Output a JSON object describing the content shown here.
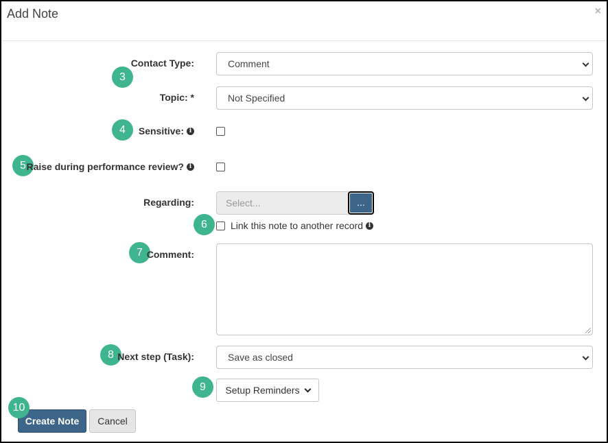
{
  "modal": {
    "title": "Add Note",
    "close_symbol": "×"
  },
  "form": {
    "contact_type": {
      "label": "Contact Type:",
      "value": "Comment"
    },
    "topic": {
      "label": "Topic: *",
      "value": "Not Specified"
    },
    "sensitive": {
      "label": "Sensitive:",
      "checked": false
    },
    "raise_review": {
      "label": "Raise during performance review?",
      "checked": false
    },
    "regarding": {
      "label": "Regarding:",
      "placeholder": "Select...",
      "button_label": "..."
    },
    "link_record": {
      "label": "Link this note to another record",
      "checked": false
    },
    "comment": {
      "label": "Comment:",
      "value": ""
    },
    "next_step": {
      "label": "Next step (Task):",
      "value": "Save as closed"
    },
    "reminders": {
      "label": "Setup Reminders"
    }
  },
  "footer": {
    "create_label": "Create Note",
    "cancel_label": "Cancel"
  },
  "badges": [
    "3",
    "4",
    "5",
    "6",
    "7",
    "8",
    "9",
    "10"
  ],
  "icons": {
    "info": "info-circle-icon",
    "chevron": "chevron-down-icon",
    "close": "close-icon",
    "resize": "resize-handle-icon"
  },
  "colors": {
    "primary": "#3d6489",
    "badge": "#3fb58f",
    "border": "#c6c6c6"
  }
}
